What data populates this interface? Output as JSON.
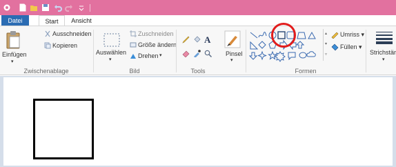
{
  "tabs": {
    "file": "Datei",
    "start": "Start",
    "view": "Ansicht"
  },
  "clipboard": {
    "paste": "Einfügen",
    "cut": "Ausschneiden",
    "copy": "Kopieren",
    "group": "Zwischenablage"
  },
  "image": {
    "select": "Auswählen",
    "crop": "Zuschneiden",
    "resize": "Größe ändern",
    "rotate": "Drehen",
    "group": "Bild"
  },
  "tools": {
    "group": "Tools",
    "brush": "Pinsel"
  },
  "shapes": {
    "outline": "Umriss",
    "fill": "Füllen",
    "group": "Formen"
  },
  "size": {
    "label": "Strichstärke"
  },
  "icons": {
    "paint": "paint-app-icon",
    "new": "new-file-icon",
    "open": "open-icon",
    "save": "save-icon",
    "undo": "undo-icon",
    "redo": "redo-icon",
    "qat_menu": "customize-menu-icon"
  },
  "colors": {
    "titlebar": "#e2719f",
    "file_tab": "#2b6cb3",
    "highlight": "#e21c1c"
  }
}
